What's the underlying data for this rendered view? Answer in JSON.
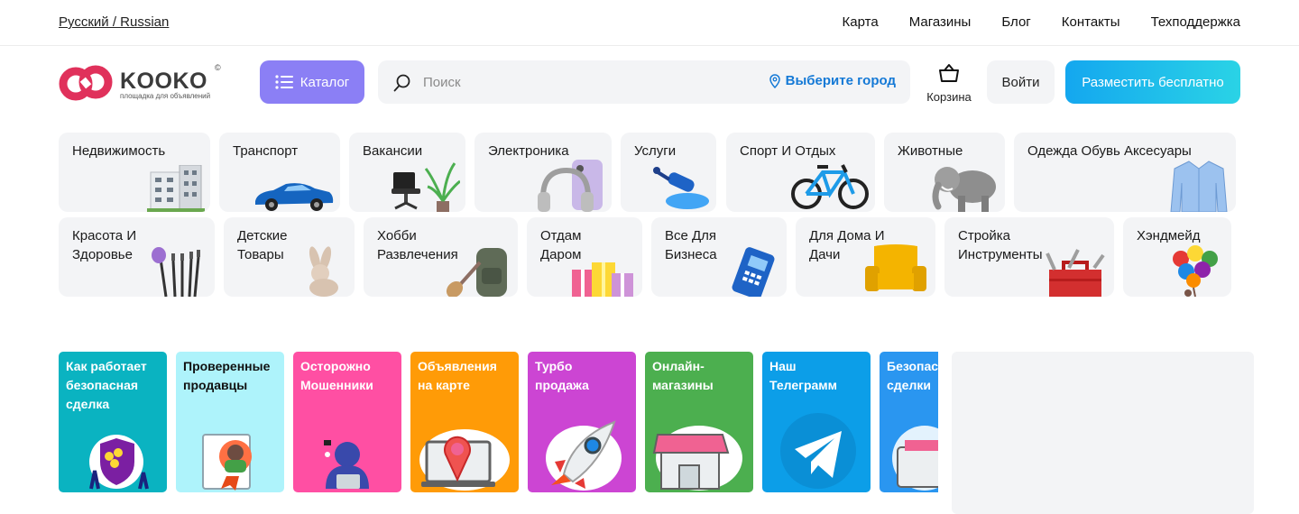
{
  "topbar": {
    "language": "Русский / Russian",
    "nav": [
      "Карта",
      "Магазины",
      "Блог",
      "Контакты",
      "Техподдержка"
    ]
  },
  "header": {
    "logo_text": "KOOKO",
    "logo_reg": "©",
    "logo_sub": "площадка для объявлений",
    "catalog_label": "Каталог",
    "search_placeholder": "Поиск",
    "city_label": "Выберите город",
    "cart_label": "Корзина",
    "login_label": "Войти",
    "post_label": "Разместить бесплатно"
  },
  "categories": [
    {
      "label": "Недвижимость",
      "icon": "building-icon"
    },
    {
      "label": "Транспорт",
      "icon": "car-icon"
    },
    {
      "label": "Вакансии",
      "icon": "office-chair-icon"
    },
    {
      "label": "Электроника",
      "icon": "headphones-icon"
    },
    {
      "label": "Услуги",
      "icon": "paint-roller-icon"
    },
    {
      "label": "Спорт И Отдых",
      "icon": "bicycle-icon"
    },
    {
      "label": "Животные",
      "icon": "elephant-icon"
    },
    {
      "label": "Одежда Обувь Аксесуары",
      "icon": "shirt-icon"
    },
    {
      "label": "Красота И\nЗдоровье",
      "icon": "makeup-brushes-icon"
    },
    {
      "label": "Детские\nТовары",
      "icon": "toy-bunny-icon"
    },
    {
      "label": "Хобби\nРазвлечения",
      "icon": "guitar-backpack-icon"
    },
    {
      "label": "Отдам\nДаром",
      "icon": "gift-boxes-icon"
    },
    {
      "label": "Все Для\nБизнеса",
      "icon": "card-terminal-icon"
    },
    {
      "label": "Для Дома И\nДачи",
      "icon": "armchair-icon"
    },
    {
      "label": "Стройка\nИнструменты",
      "icon": "toolbox-icon"
    },
    {
      "label": "Хэндмейд",
      "icon": "balloons-icon"
    }
  ],
  "promos": [
    {
      "label": "Как работает\nбезопасная\nсделка",
      "color": "#0ab3c1",
      "icon": "shield-coins-icon"
    },
    {
      "label": "Проверенные\nпродавцы",
      "color": "#aef3fb",
      "icon": "verified-seller-icon"
    },
    {
      "label": "Осторожно\nМошенники",
      "color": "#ff4fa3",
      "icon": "hacker-icon"
    },
    {
      "label": "Объявления\nна карте",
      "color": "#ff9b07",
      "icon": "map-pin-laptop-icon"
    },
    {
      "label": "Турбо\nпродажа",
      "color": "#cc45d3",
      "icon": "rocket-icon"
    },
    {
      "label": "Онлайн-\nмагазины",
      "color": "#4caf4f",
      "icon": "storefront-icon"
    },
    {
      "label": "Наш\nТелеграмм",
      "color": "#0c9ee8",
      "icon": "telegram-icon"
    },
    {
      "label": "Безопасные\nсделки",
      "color": "#2a96f0",
      "icon": "wallet-icon"
    }
  ]
}
